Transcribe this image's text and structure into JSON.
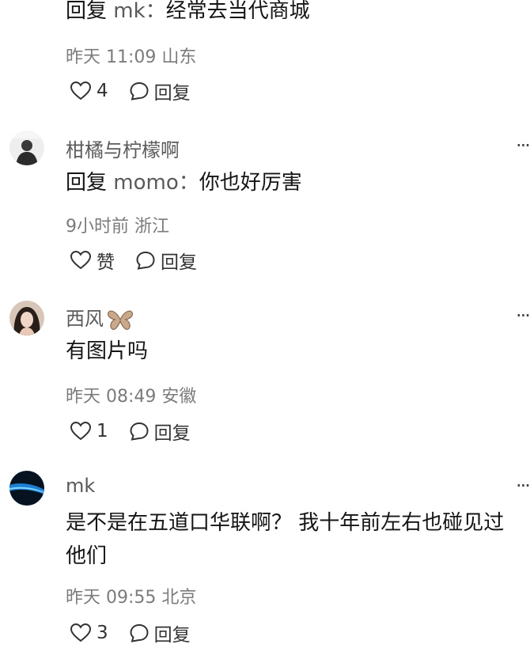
{
  "comments": [
    {
      "content_prefix": "回复",
      "reply_target": "mk：",
      "content_text": "经常去当代商城",
      "meta": "昨天 11:09 山东",
      "like_label": "4",
      "reply_label": "回复"
    },
    {
      "username": "柑橘与柠檬啊",
      "content_prefix": "回复",
      "reply_target": "momo：",
      "content_text": "你也好厉害",
      "meta": "9小时前 浙江",
      "like_label": "赞",
      "reply_label": "回复",
      "more": "···"
    },
    {
      "username": "西风",
      "badge_icon": "butterfly-icon",
      "content_text": "有图片吗",
      "meta": "昨天 08:49 安徽",
      "like_label": "1",
      "reply_label": "回复",
      "more": "···"
    },
    {
      "username": "mk",
      "content_line1": "是不是在五道口华联啊？ 我十年前左右也碰见过",
      "content_line2": "他们",
      "meta": "昨天 09:55 北京",
      "like_label": "3",
      "reply_label": "回复",
      "more": "···"
    }
  ],
  "icons": {
    "like": "heart-outline-icon",
    "reply": "speech-bubble-icon"
  },
  "colors": {
    "text": "#151515",
    "username": "#5a5a5a",
    "meta": "#7b7b7b"
  }
}
